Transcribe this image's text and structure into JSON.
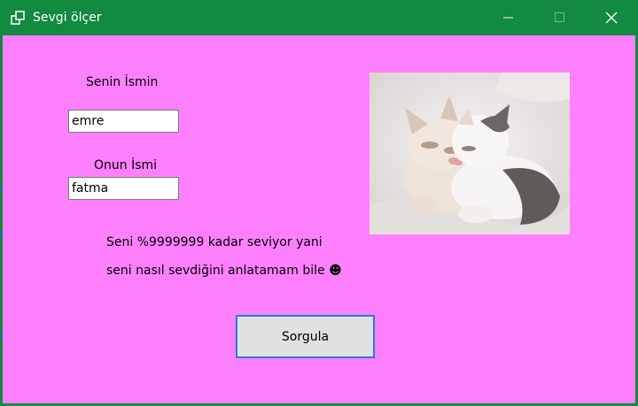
{
  "window": {
    "title": "Sevgi ölçer",
    "colors": {
      "titlebar": "#128a40",
      "client": "#ff80ff",
      "button_border": "#2a7ad8"
    }
  },
  "titlebar_controls": {
    "minimize_icon": "minimize-icon",
    "maximize_icon": "maximize-icon",
    "close_icon": "close-icon"
  },
  "form": {
    "your_name_label": "Senin İsmin",
    "your_name_value": "emre",
    "their_name_label": "Onun İsmi",
    "their_name_value": "fatma",
    "result_line1": "Seni %9999999 kadar seviyor yani",
    "result_line2": "seni nasıl sevdiğini anlatamam bile ☻",
    "query_button": "Sorgula"
  },
  "image": {
    "depicts": "two-kittens-cuddling-photo"
  }
}
